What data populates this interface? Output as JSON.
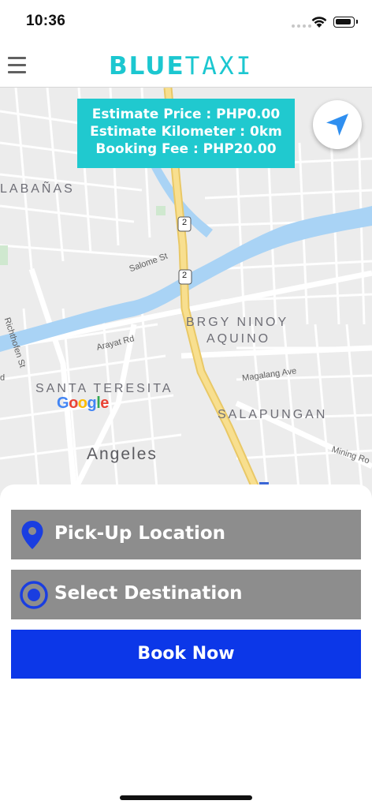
{
  "status_bar": {
    "time": "10:36"
  },
  "header": {
    "logo_part1": "BLUE",
    "logo_part2": "TAXI"
  },
  "estimate": {
    "price": "Estimate Price : PHP0.00",
    "kilometer": "Estimate Kilometer : 0km",
    "booking_fee": "Booking Fee : PHP20.00"
  },
  "map": {
    "labels": {
      "labanas": "LABAÑAS",
      "salome": "Salome St",
      "richthofen": "Richthofen St",
      "arayat": "Arayat Rd",
      "brgy_line1": "BRGY NINOY",
      "brgy_line2": "AQUINO",
      "magalang": "Magalang Ave",
      "santa_teresita": "SANTA TERESITA",
      "salapungan": "SALAPUNGAN",
      "angeles": "Angeles",
      "mining": "Mining Ro",
      "d_fragment": "d",
      "route_shield": "2"
    },
    "attribution": "Google",
    "colors": {
      "river": "#a9d3f5",
      "highway": "#f5d67a",
      "land": "#ececec",
      "road": "#ffffff"
    }
  },
  "booking": {
    "pickup_label": "Pick-Up Location",
    "destination_label": "Select Destination",
    "book_label": "Book Now",
    "accent_color": "#0c37e8",
    "pin_color": "#1a3ee0"
  }
}
